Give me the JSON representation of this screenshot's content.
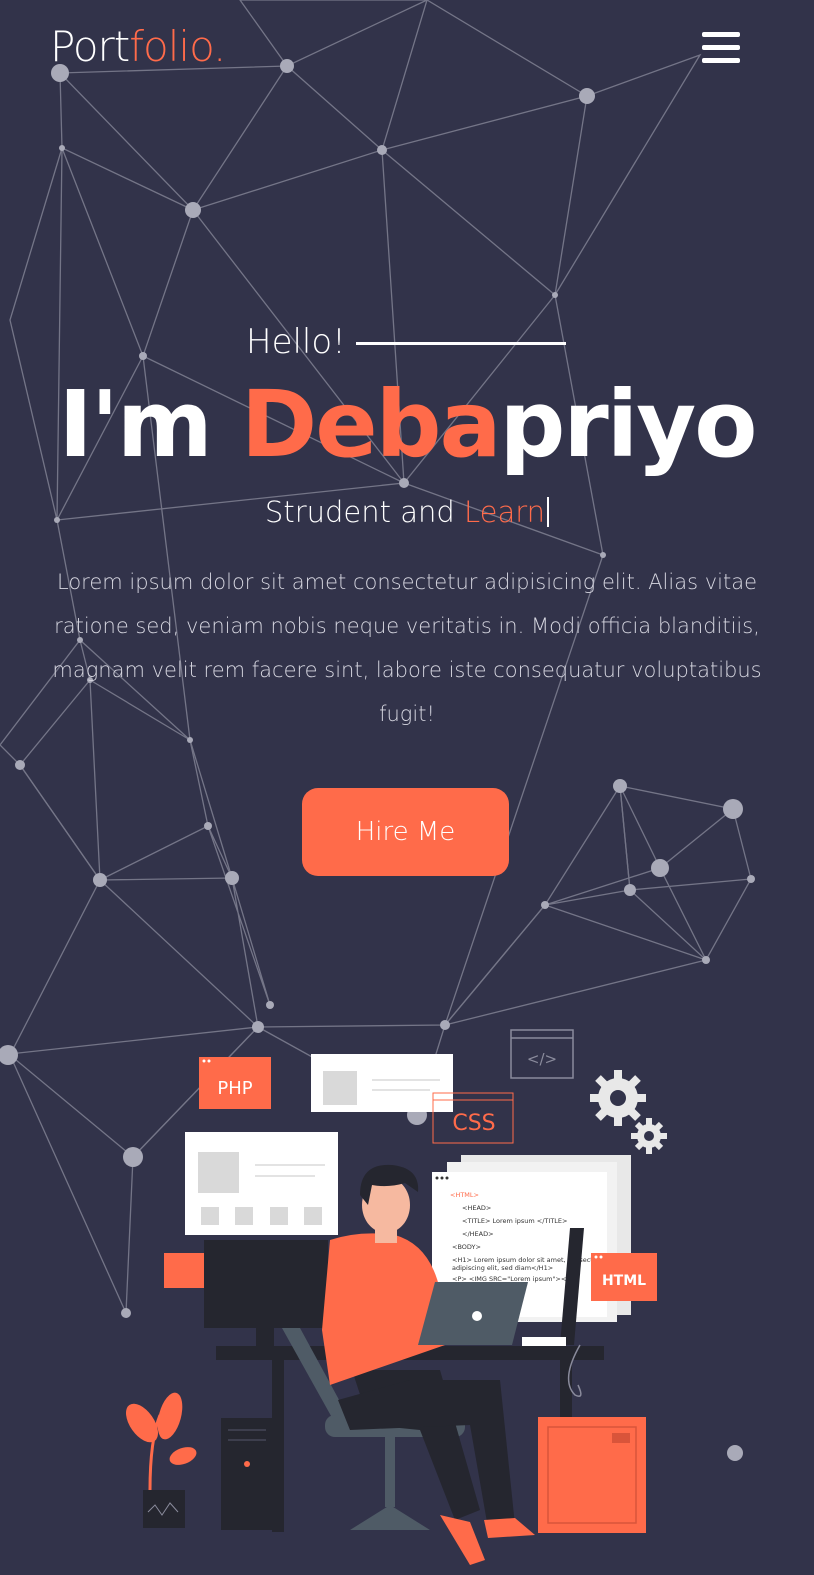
{
  "header": {
    "logo_part1": "Port",
    "logo_part2": "folio.",
    "menu_icon": "hamburger-icon"
  },
  "hero": {
    "greeting": "Hello!",
    "name_prefix": "I'm ",
    "name_highlight": "Deba",
    "name_rest": "priyo",
    "role_static": "Strudent and ",
    "role_typed": "Learn",
    "description": "Lorem ipsum dolor sit amet consectetur adipisicing elit. Alias vitae ratione sed, veniam nobis neque veritatis in. Modi officia blanditiis, magnam velit rem facere sint, labore iste consequatur voluptatibus fugit!",
    "cta_label": "Hire Me"
  },
  "illustration": {
    "php_label": "PHP",
    "css_label": "CSS",
    "html_label": "HTML",
    "code_line_1": "<HTML>",
    "code_line_2": "<HEAD>",
    "code_line_3": "<TITLE> Lorem ipsum </TITLE>",
    "code_line_4": "</HEAD>",
    "code_line_5": "<BODY>",
    "code_line_6": "<H1> Lorem ipsum dolor sit amet, consectetur",
    "code_line_7": "adipiscing elit, sed diam</H1>",
    "code_line_8": "<P> <IMG SRC=\"Lorem ipsum\"></P>",
    "code_tag_icon": "</>"
  },
  "colors": {
    "background": "#32334a",
    "accent": "#ff6b4a",
    "text": "#ffffff"
  }
}
